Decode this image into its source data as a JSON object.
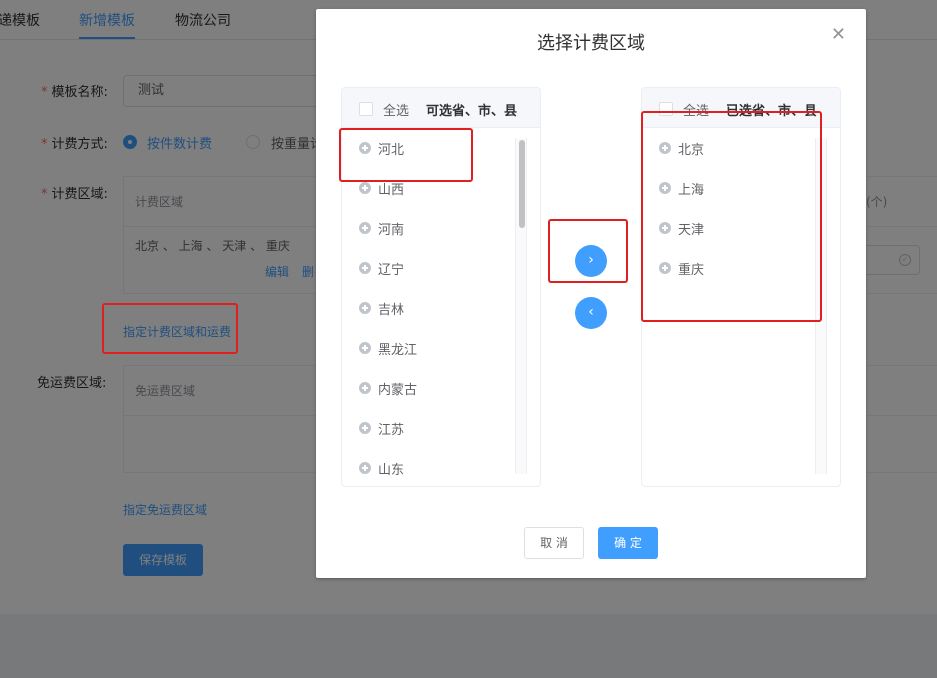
{
  "tabs": [
    {
      "label": "递模板"
    },
    {
      "label": "新增模板"
    },
    {
      "label": "物流公司"
    }
  ],
  "form": {
    "name_label": "模板名称:",
    "name_value": "测试",
    "method_label": "计费方式:",
    "method_options": [
      "按件数计费",
      "按重量计"
    ],
    "area_label": "计费区域:",
    "area_header": "计费区域",
    "area_value": "北京 、 上海 、 天津 、 重庆",
    "area_edit": "编辑",
    "area_delete": "删",
    "assign_area_link": "指定计费区域和运费",
    "free_label": "免运费区域:",
    "free_header": "免运费区域",
    "assign_free_link": "指定免运费区域",
    "save_button": "保存模板",
    "right_header": "(个)",
    "required_mark": "*"
  },
  "dialog": {
    "title": "选择计费区域",
    "left_panel": {
      "select_all": "全选",
      "title": "可选省、市、县",
      "items": [
        "河北",
        "山西",
        "河南",
        "辽宁",
        "吉林",
        "黑龙江",
        "内蒙古",
        "江苏",
        "山东"
      ]
    },
    "right_panel": {
      "select_all": "全选",
      "title": "已选省、市、县",
      "items": [
        "北京",
        "上海",
        "天津",
        "重庆"
      ]
    },
    "cancel_label": "取 消",
    "confirm_label": "确 定"
  },
  "colors": {
    "accent": "#409eff",
    "annotation": "#e02020"
  }
}
